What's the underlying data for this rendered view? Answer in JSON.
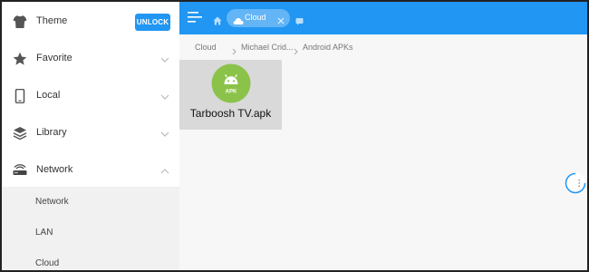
{
  "sidebar": {
    "items": [
      {
        "label": "Theme",
        "icon": "shirt-icon"
      },
      {
        "label": "Favorite",
        "icon": "star-icon"
      },
      {
        "label": "Local",
        "icon": "phone-icon"
      },
      {
        "label": "Library",
        "icon": "layers-icon"
      },
      {
        "label": "Network",
        "icon": "router-icon"
      }
    ],
    "unlock_label": "UNLOCK",
    "network_sub": [
      "Network",
      "LAN",
      "Cloud"
    ]
  },
  "topbar": {
    "tab_label": "Cloud"
  },
  "breadcrumb": [
    "Cloud",
    "Michael Crid...",
    "Android APKs"
  ],
  "files": [
    {
      "name": "Tarboosh TV.apk",
      "badge": "APK"
    }
  ],
  "colors": {
    "accent": "#2196f3",
    "apk_green": "#8bc34a",
    "tab_chip": "#64b5f6"
  }
}
